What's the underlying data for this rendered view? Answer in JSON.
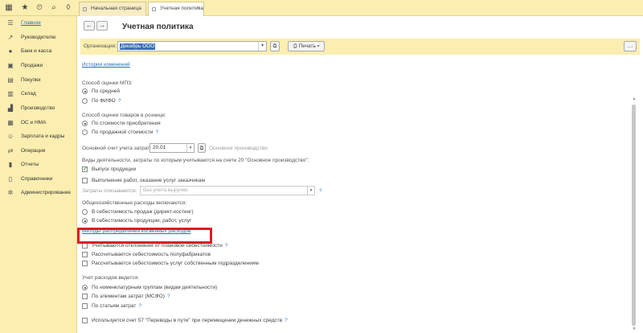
{
  "sidebar": {
    "items": [
      {
        "label": "Главное",
        "icon": "list-icon",
        "active": true
      },
      {
        "label": "Руководителю",
        "icon": "chart-icon"
      },
      {
        "label": "Банк и касса",
        "icon": "coin-icon"
      },
      {
        "label": "Продажи",
        "icon": "cart-icon"
      },
      {
        "label": "Покупки",
        "icon": "basket-icon"
      },
      {
        "label": "Склад",
        "icon": "box-icon"
      },
      {
        "label": "Производство",
        "icon": "factory-icon"
      },
      {
        "label": "ОС и НМА",
        "icon": "building-icon"
      },
      {
        "label": "Зарплата и кадры",
        "icon": "people-icon"
      },
      {
        "label": "Операции",
        "icon": "operations-icon"
      },
      {
        "label": "Отчеты",
        "icon": "report-icon"
      },
      {
        "label": "Справочники",
        "icon": "book-icon"
      },
      {
        "label": "Администрирование",
        "icon": "gear-icon"
      }
    ]
  },
  "tabs": [
    {
      "label": "Начальная страница"
    },
    {
      "label": "Учетная политика",
      "close": "×"
    }
  ],
  "page": {
    "title": "Учетная политика",
    "org_label": "Организация:",
    "org_value": "Декабрь ООО",
    "print_label": "Печать",
    "more_label": "…",
    "history_link": "История изменений",
    "mpz_label": "Способ оценки МПЗ:",
    "mpz_opt1": "По средней",
    "mpz_opt2": "По ФИФО",
    "retail_label": "Способ оценки товаров в рознице:",
    "retail_opt1": "По стоимости приобретения",
    "retail_opt2": "По продажной стоимости",
    "acct_label": "Основной счет учета затрат:",
    "acct_value": "20.01",
    "acct_hint": "Основное производство",
    "activity_label": "Виды деятельности, затраты по которым учитываются на счете 20 \"Основное производство\":",
    "cb_products": "Выпуск продукции",
    "cb_works": "Выполнение работ, оказание услуг заказчикам",
    "writeoff_label": "Затраты списываются:",
    "writeoff_value": "Без учета выручки",
    "overhead_label": "Общехозяйственные расходы включаются:",
    "overhead_opt1": "В себестоимость продаж (директ-костинг)",
    "overhead_opt2": "В себестоимость продукции, работ, услуг",
    "methods_link": "Методы распределения косвенных расходов",
    "cb_deviations": "Учитываются отклонения от плановой себестоимости",
    "cb_semis": "Рассчитывается себестоимость полуфабрикатов",
    "cb_services": "Рассчитывается себестоимость услуг собственным подразделениям",
    "costacc_label": "Учет расходов ведется:",
    "costacc_opt1": "По номенклатурным группам (видам деятельности)",
    "cb_elements": "По элементам затрат (МСФО)",
    "cb_articles": "По статьям затрат",
    "cb_57": "Используется счет 57 \"Переводы в пути\" при перемещении денежных средств",
    "q": "?"
  }
}
